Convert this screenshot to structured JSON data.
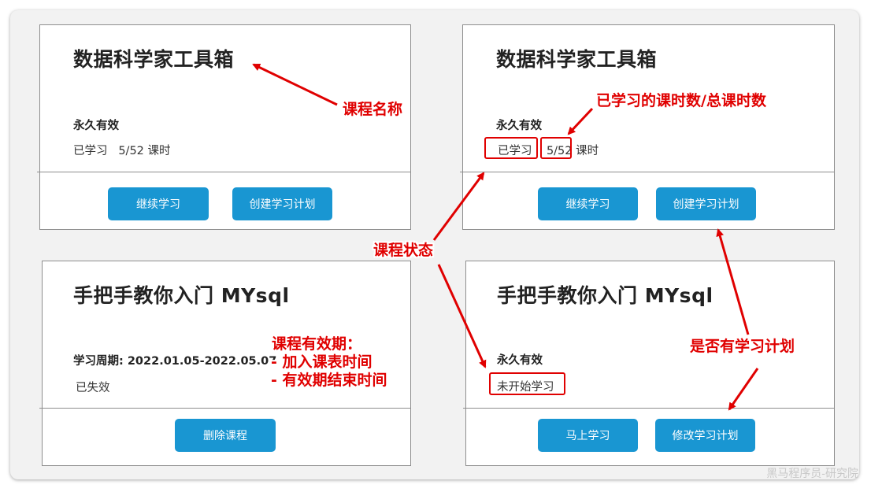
{
  "cards": [
    {
      "title": "数据科学家工具箱",
      "validity": "永久有效",
      "status_label": "已学习",
      "status_progress": "5/52",
      "status_unit": "课时",
      "buttons": [
        "继续学习",
        "创建学习计划"
      ]
    },
    {
      "title": "数据科学家工具箱",
      "validity": "永久有效",
      "status_label": "已学习",
      "status_progress": "5/52",
      "status_unit": "课时",
      "buttons": [
        "继续学习",
        "创建学习计划"
      ]
    },
    {
      "title": "手把手教你入门 MYsql",
      "validity": "学习周期: 2022.01.05-2022.05.07",
      "status_label": "已失效",
      "buttons": [
        "删除课程"
      ]
    },
    {
      "title": "手把手教你入门 MYsql",
      "validity": "永久有效",
      "status_label": "未开始学习",
      "buttons": [
        "马上学习",
        "修改学习计划"
      ]
    }
  ],
  "annotations": {
    "course_name": "课程名称",
    "progress": "已学习的课时数/总课时数",
    "course_status": "课程状态",
    "validity_line1": "课程有效期：",
    "validity_line2": "- 加入课表时间",
    "validity_line3": "- 有效期结束时间",
    "has_plan": "是否有学习计划"
  },
  "watermark": "黑马程序员-研究院",
  "colors": {
    "button": "#1996d2",
    "annotation": "#e00000",
    "frame_background": "#f2f2f2",
    "card_border": "#8e8e8e"
  }
}
